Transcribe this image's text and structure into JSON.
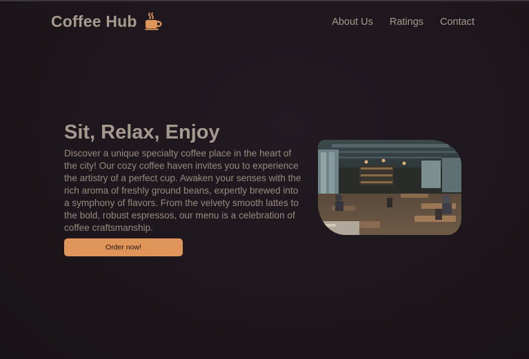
{
  "brand": {
    "name": "Coffee Hub",
    "icon": "coffee-cup-icon",
    "accent_color": "#e0955a"
  },
  "nav": {
    "links": [
      {
        "label": "About Us"
      },
      {
        "label": "Ratings"
      },
      {
        "label": "Contact"
      }
    ]
  },
  "hero": {
    "title": "Sit, Relax, Enjoy",
    "description": "Discover a unique specialty coffee place in the heart of the city! Our cozy coffee haven invites you to experience the artistry of a perfect cup. Awaken your senses with the rich aroma of freshly ground beans, expertly brewed into a symphony of flavors. From the velvety smooth lattes to the bold, robust espressos, our menu is a celebration of coffee craftsmanship.",
    "button_label": "Order now!",
    "image_subject": "cafe-interior-photo"
  },
  "colors": {
    "background": "#1e171d",
    "text": "#a59a8f",
    "button": "#e0955a"
  }
}
